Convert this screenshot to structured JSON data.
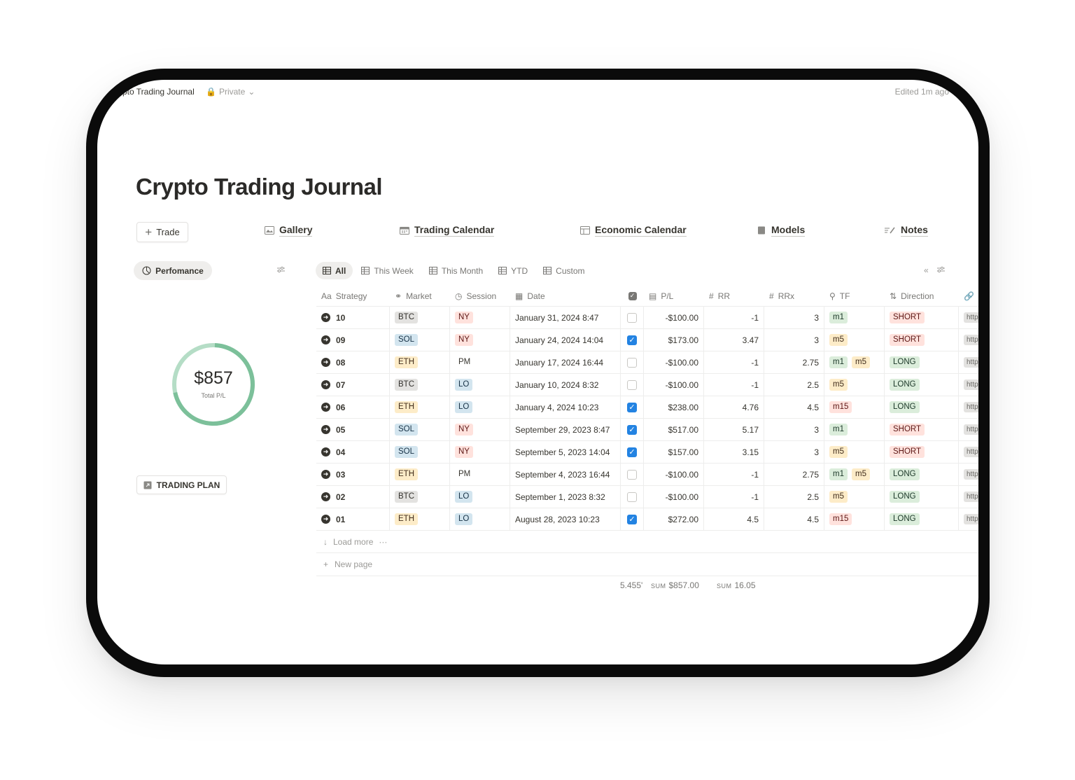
{
  "topbar": {
    "breadcrumb": "ypto Trading Journal",
    "privacy": "Private",
    "edited": "Edited 1m ago"
  },
  "page": {
    "title": "Crypto Trading Journal"
  },
  "actions": {
    "trade_label": "Trade"
  },
  "nav": [
    {
      "label": "Gallery",
      "icon": "image-icon"
    },
    {
      "label": "Trading Calendar",
      "icon": "calendar-icon"
    },
    {
      "label": "Economic Calendar",
      "icon": "calendar-icon"
    },
    {
      "label": "Models",
      "icon": "book-icon"
    },
    {
      "label": "Notes",
      "icon": "pencil-lines-icon"
    }
  ],
  "performance": {
    "label": "Perfomance",
    "total": "$857",
    "total_label": "Total P/L",
    "ring_colors": [
      "#7cc09a",
      "#b5ddc6"
    ]
  },
  "trading_plan": {
    "label": "TRADING PLAN"
  },
  "views": {
    "tabs": [
      "All",
      "This Week",
      "This Month",
      "YTD",
      "Custom"
    ],
    "active": "All"
  },
  "table": {
    "columns": {
      "strategy": "Strategy",
      "market": "Market",
      "session": "Session",
      "date": "Date",
      "pl": "P/L",
      "rr": "RR",
      "rrx": "RRx",
      "tf": "TF",
      "direction": "Direction"
    },
    "rows": [
      {
        "strategy": "10",
        "market": "BTC",
        "session": "NY",
        "date": "January 31, 2024 8:47",
        "checked": false,
        "pl": "-$100.00",
        "rr": "-1",
        "rrx": "3",
        "tf": [
          "m1"
        ],
        "direction": "SHORT",
        "link": "http"
      },
      {
        "strategy": "09",
        "market": "SOL",
        "session": "NY",
        "date": "January 24, 2024 14:04",
        "checked": true,
        "pl": "$173.00",
        "rr": "3.47",
        "rrx": "3",
        "tf": [
          "m5"
        ],
        "direction": "SHORT",
        "link": "http"
      },
      {
        "strategy": "08",
        "market": "ETH",
        "session": "PM",
        "date": "January 17, 2024 16:44",
        "checked": false,
        "pl": "-$100.00",
        "rr": "-1",
        "rrx": "2.75",
        "tf": [
          "m1",
          "m5"
        ],
        "direction": "LONG",
        "link": "http"
      },
      {
        "strategy": "07",
        "market": "BTC",
        "session": "LO",
        "date": "January 10, 2024 8:32",
        "checked": false,
        "pl": "-$100.00",
        "rr": "-1",
        "rrx": "2.5",
        "tf": [
          "m5"
        ],
        "direction": "LONG",
        "link": "http"
      },
      {
        "strategy": "06",
        "market": "ETH",
        "session": "LO",
        "date": "January 4, 2024 10:23",
        "checked": true,
        "pl": "$238.00",
        "rr": "4.76",
        "rrx": "4.5",
        "tf": [
          "m15"
        ],
        "direction": "LONG",
        "link": "http"
      },
      {
        "strategy": "05",
        "market": "SOL",
        "session": "NY",
        "date": "September 29, 2023 8:47",
        "checked": true,
        "pl": "$517.00",
        "rr": "5.17",
        "rrx": "3",
        "tf": [
          "m1"
        ],
        "direction": "SHORT",
        "link": "http"
      },
      {
        "strategy": "04",
        "market": "SOL",
        "session": "NY",
        "date": "September 5, 2023 14:04",
        "checked": true,
        "pl": "$157.00",
        "rr": "3.15",
        "rrx": "3",
        "tf": [
          "m5"
        ],
        "direction": "SHORT",
        "link": "http"
      },
      {
        "strategy": "03",
        "market": "ETH",
        "session": "PM",
        "date": "September 4, 2023 16:44",
        "checked": false,
        "pl": "-$100.00",
        "rr": "-1",
        "rrx": "2.75",
        "tf": [
          "m1",
          "m5"
        ],
        "direction": "LONG",
        "link": "http"
      },
      {
        "strategy": "02",
        "market": "BTC",
        "session": "LO",
        "date": "September 1, 2023 8:32",
        "checked": false,
        "pl": "-$100.00",
        "rr": "-1",
        "rrx": "2.5",
        "tf": [
          "m5"
        ],
        "direction": "LONG",
        "link": "http"
      },
      {
        "strategy": "01",
        "market": "ETH",
        "session": "LO",
        "date": "August 28, 2023 10:23",
        "checked": true,
        "pl": "$272.00",
        "rr": "4.5",
        "rrx": "4.5",
        "tf": [
          "m15"
        ],
        "direction": "LONG",
        "link": "http"
      }
    ],
    "load_more": "Load more",
    "new_page": "New page"
  },
  "summary": {
    "checked_stat": "5.455'",
    "sum_key": "SUM",
    "pl_sum": "$857.00",
    "rrx_sum": "16.05"
  }
}
